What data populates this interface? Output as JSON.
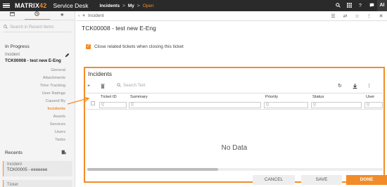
{
  "colors": {
    "accent": "#f28c28",
    "topbar": "#2a2a2a"
  },
  "topbar": {
    "menu_icon": "hamburger-icon",
    "logo_main": "MATRIX",
    "logo_accent": "42",
    "app_name": "Service Desk",
    "breadcrumb": [
      "Incidents",
      ">",
      "My",
      ">",
      "Open"
    ],
    "icons": [
      "search-icon",
      "grid-icon",
      "help-icon",
      "chat-icon"
    ],
    "avatar": "AI"
  },
  "sidebar": {
    "tabs": [
      "pin-icon",
      "history-icon",
      "star-icon"
    ],
    "search_placeholder": "Search in Recent Items",
    "in_progress_title": "In Progress",
    "in_progress_item": {
      "type": "Incident",
      "title": "TCK00008 - test new E-Eng"
    },
    "related": [
      "General",
      "Attachments",
      "Time Tracking",
      "User Ratings",
      "Caused By",
      "Incidents",
      "Assets",
      "Services",
      "Users",
      "Tasks"
    ],
    "active_related": "Incidents",
    "recents_title": "Recents",
    "recents": [
      {
        "type": "Incident",
        "value": "TCK00005 - eeeeeee"
      },
      {
        "type": "Ticket",
        "value": ""
      }
    ]
  },
  "main": {
    "tab_label": "Incident",
    "ticket_title": "TCK00008 - test new E-Eng",
    "close_related_label": "Close related tickets when closing this ticket",
    "panel": {
      "title": "Incidents",
      "search_placeholder": "Search Text",
      "columns": [
        "Ticket ID",
        "Summary",
        "Priority",
        "Status",
        "User"
      ],
      "no_data": "No Data"
    }
  },
  "footer": {
    "cancel": "CANCEL",
    "save": "SAVE",
    "done": "DONE"
  }
}
